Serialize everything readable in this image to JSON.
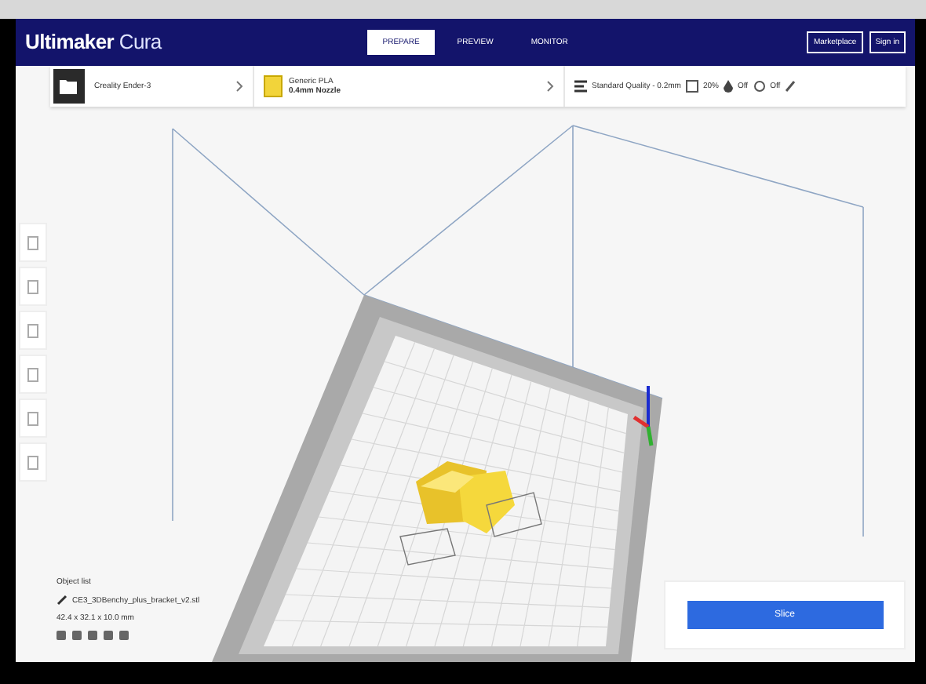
{
  "app": {
    "logo_bold": "Ultimaker",
    "logo_light": "Cura"
  },
  "stages": [
    {
      "label": "PREPARE",
      "selected": true
    },
    {
      "label": "PREVIEW",
      "selected": false
    },
    {
      "label": "MONITOR",
      "selected": false
    }
  ],
  "account_buttons": [
    "Marketplace",
    "Sign in"
  ],
  "printer": {
    "name": "Creality Ender-3"
  },
  "material": {
    "name": "Generic PLA",
    "nozzle": "0.4mm Nozzle",
    "color": "#f2d43a"
  },
  "print_settings": {
    "profile": "Standard Quality - 0.2mm",
    "infill": "20%",
    "support": "Off",
    "adhesion": "Off"
  },
  "object_list": {
    "label": "Object list",
    "file": "CE3_3DBenchy_plus_bracket_v2.stl",
    "dimensions": "42.4 x 32.1 x 10.0 mm"
  },
  "slice_button": "Slice"
}
